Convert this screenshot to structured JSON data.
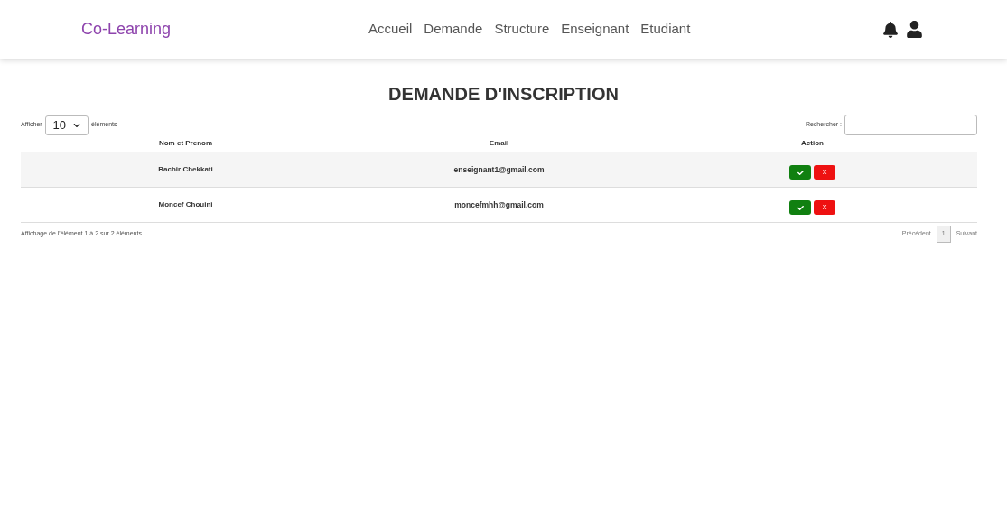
{
  "navbar": {
    "brand": "Co-Learning",
    "links": [
      "Accueil",
      "Demande",
      "Structure",
      "Enseignant",
      "Etudiant"
    ]
  },
  "title": "DEMANDE D'INSCRIPTION",
  "length_control": {
    "before": "Afficher",
    "value": "10",
    "after": "éléments"
  },
  "search": {
    "label": "Rechercher :"
  },
  "table": {
    "columns": [
      "Nom et Prenom",
      "Email",
      "Action"
    ],
    "rows": [
      {
        "name": "Bachir Chekkati",
        "email": "enseignant1@gmail.com",
        "reject": "X"
      },
      {
        "name": "Moncef Chouini",
        "email": "moncefmhh@gmail.com",
        "reject": "X"
      }
    ]
  },
  "info": "Affichage de l'élément 1 à 2 sur 2 éléments",
  "pagination": {
    "previous": "Précédent",
    "pages": [
      {
        "label": "1",
        "selected": true
      }
    ],
    "next": "Suivant"
  }
}
